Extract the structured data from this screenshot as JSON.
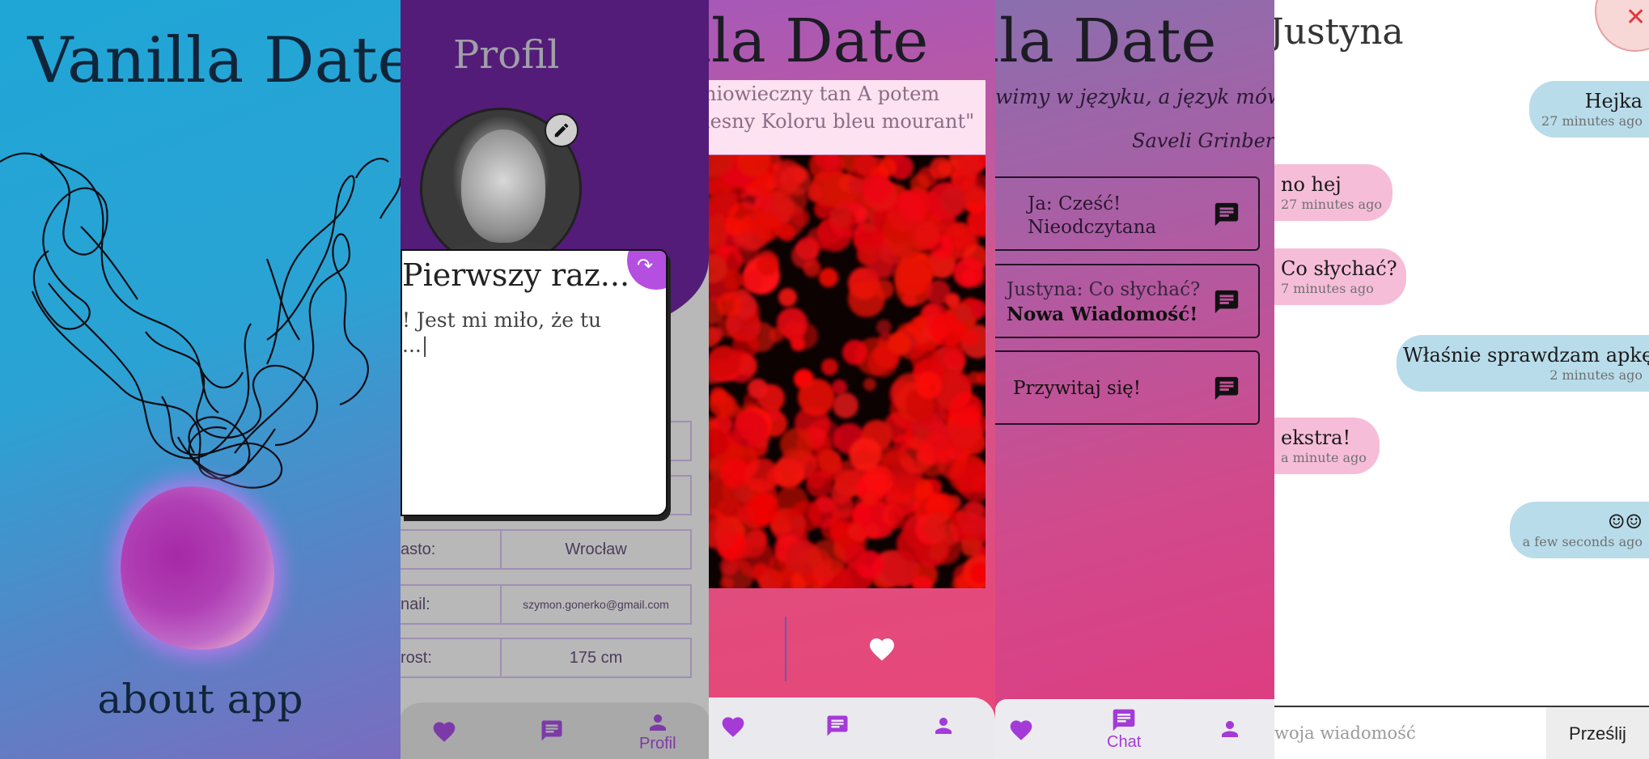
{
  "colors": {
    "accent_purple": "#a43ad8",
    "profile_header": "#531c78",
    "incoming_bubble": "#f6bdd8",
    "outgoing_bubble": "#b8dcea"
  },
  "splash": {
    "title": "Vanilla Date",
    "about_label": "about app",
    "icons": [
      "tangled-line-art",
      "gradient-orb"
    ]
  },
  "profile": {
    "title": "Profil",
    "edit_icon": "pencil-icon",
    "fields": [
      {
        "label": "asto:",
        "value": "Wrocław"
      },
      {
        "label": "nail:",
        "value": "szymon.gonerko@gmail.com"
      },
      {
        "label": "rost:",
        "value": "175 cm"
      }
    ],
    "dialog": {
      "title": "Pierwszy raz...",
      "body": "! Jest mi miło, że tu\n...|",
      "action_icon": "redo-arrow-icon"
    },
    "nav": {
      "profile_label": "Profil"
    }
  },
  "match": {
    "title": "nilla Date",
    "quote_lines": [
      "niowieczny tan A potem",
      "lesny Koloru bleu mourant\""
    ],
    "like_icon": "heart-icon"
  },
  "chats": {
    "title": "nilla Date",
    "quote_line": "wimy w języku, a język mówi",
    "quote_author": "Saveli Grinberg",
    "items": [
      {
        "line1": "Ja: Cześć!",
        "line2": "Nieodczytana"
      },
      {
        "line1": "Justyna: Co słychać?",
        "line2": "Nowa Wiadomość!"
      },
      {
        "line1": "Przywitaj się!",
        "line2": ""
      }
    ],
    "nav": {
      "chat_label": "Chat"
    }
  },
  "conversation": {
    "name": "Justyna",
    "close_icon": "close-icon",
    "messages": [
      {
        "dir": "out",
        "text": "Hejka",
        "time": "27 minutes ago"
      },
      {
        "dir": "in",
        "text": "no hej",
        "time": "27 minutes ago"
      },
      {
        "dir": "in",
        "text": "Co słychać?",
        "time": "7 minutes ago"
      },
      {
        "dir": "out",
        "text": "Właśnie sprawdzam apkę",
        "time": "2 minutes ago"
      },
      {
        "dir": "in",
        "text": "ekstra!",
        "time": "a minute ago"
      },
      {
        "dir": "out",
        "text": "☺☺",
        "time": "a few seconds ago"
      }
    ],
    "input_placeholder": "woja wiadomość",
    "send_label": "Prześlij"
  }
}
